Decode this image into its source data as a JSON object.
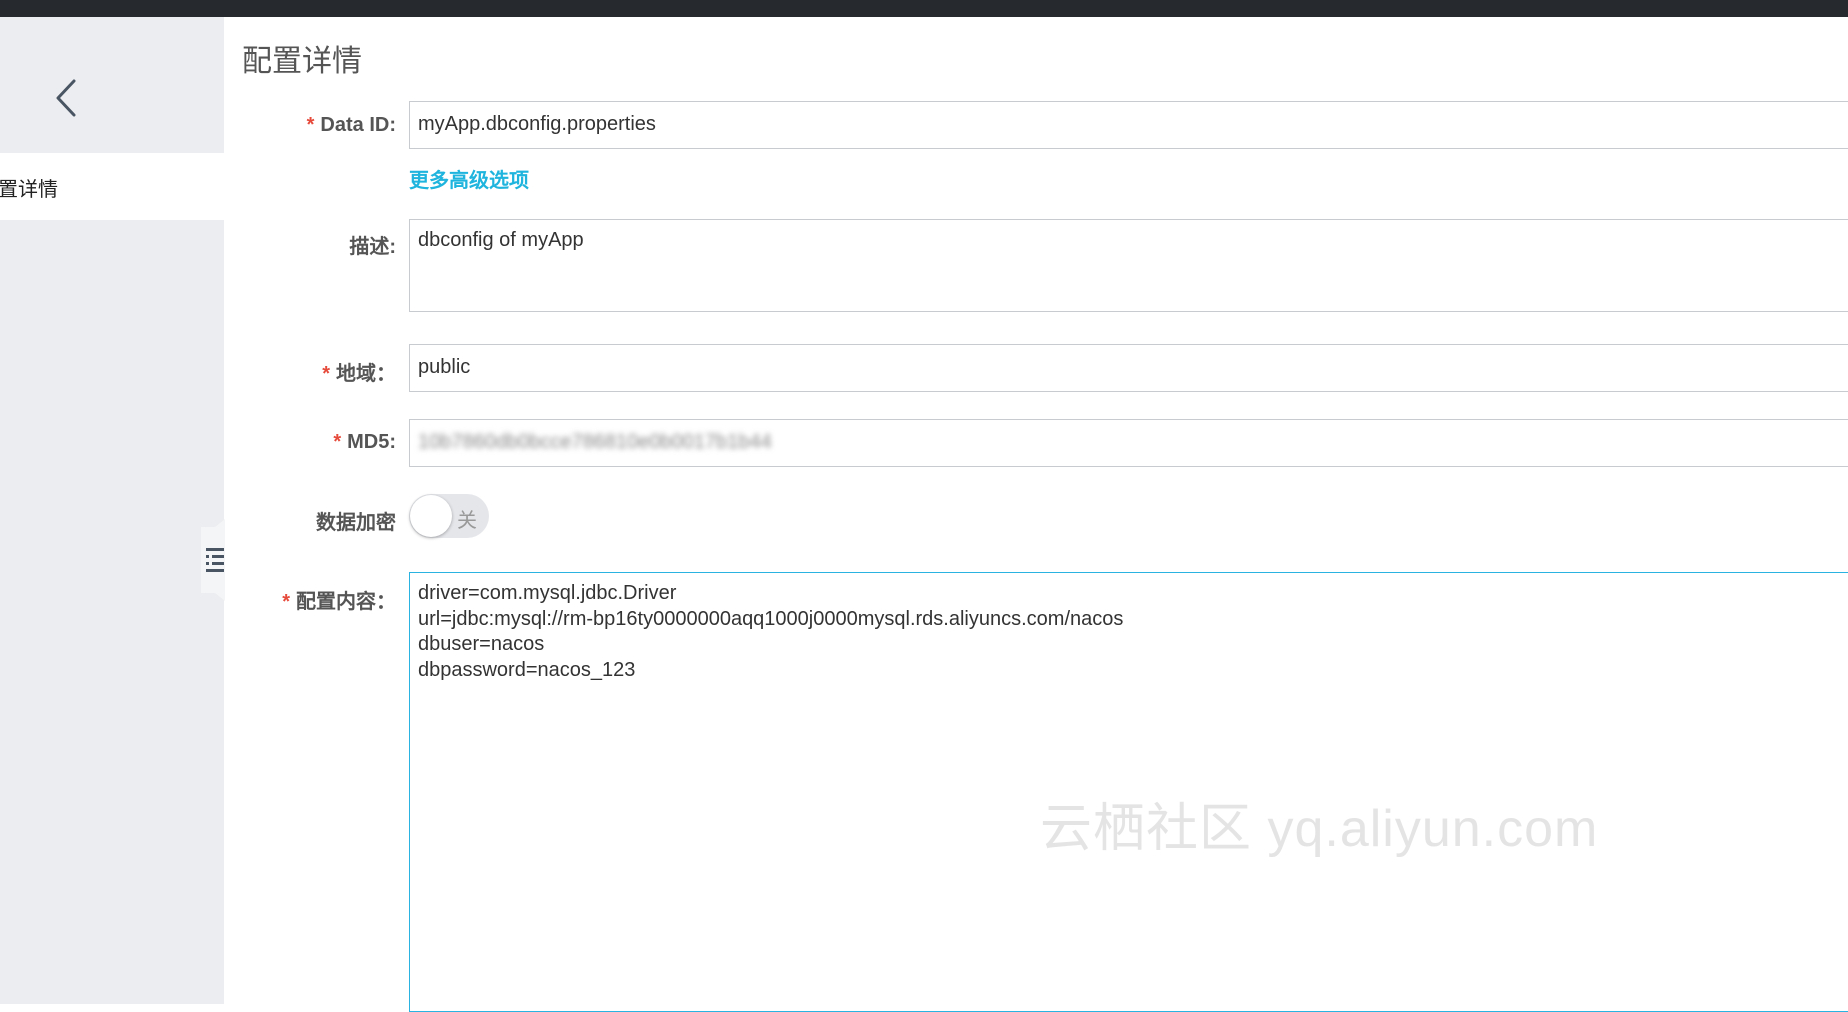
{
  "sidebar": {
    "nav_item": "置详情"
  },
  "page": {
    "title": "配置详情"
  },
  "form": {
    "data_id": {
      "required": true,
      "label": "Data ID:",
      "value": "myApp.dbconfig.properties"
    },
    "advanced_link": "更多高级选项",
    "description": {
      "required": false,
      "label": "描述:",
      "value": "dbconfig of myApp"
    },
    "region": {
      "required": true,
      "label": "地域：",
      "value": "public"
    },
    "md5": {
      "required": true,
      "label": "MD5:",
      "value": "10b7860db0bcce786810e0b0017b1b44"
    },
    "encryption": {
      "label": "数据加密",
      "toggle_text": "关",
      "checked": false
    },
    "content": {
      "required": true,
      "label": "配置内容：",
      "lines": [
        "driver=com.mysql.jdbc.Driver",
        "url=jdbc:mysql://rm-bp16ty0000000aqq1000j0000mysql.rds.aliyuncs.com/nacos",
        "dbuser=nacos",
        "dbpassword=nacos_123"
      ]
    }
  },
  "watermark": "云栖社区 yq.aliyun.com",
  "colors": {
    "topbar": "#262a2e",
    "sidebar": "#ecedf0",
    "link": "#1fb4dd",
    "required": "#e64a3b",
    "active_border": "#2ab3e0"
  },
  "icons": {
    "back": "chevron-left-icon",
    "collapse": "list-icon"
  }
}
